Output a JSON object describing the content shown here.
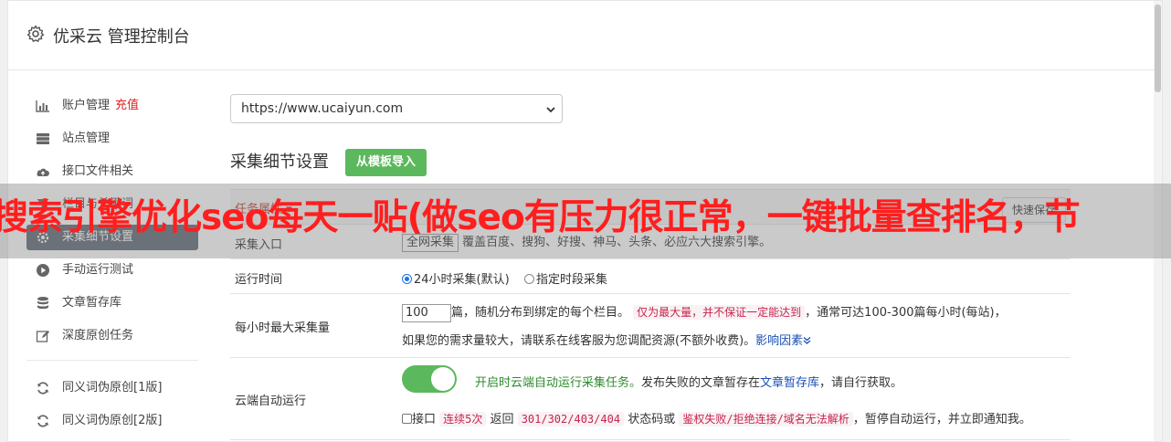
{
  "header": {
    "title": "优采云 管理控制台"
  },
  "sidebar": {
    "items": [
      {
        "label": "账户管理",
        "badge": "充值",
        "icon": "bar-chart-icon"
      },
      {
        "label": "站点管理",
        "icon": "server-icon"
      },
      {
        "label": "接口文件相关",
        "icon": "cloud-upload-icon"
      },
      {
        "label": "栏目与关键词",
        "icon": "filter-icon"
      },
      {
        "label": "采集细节设置",
        "icon": "gear-icon"
      },
      {
        "label": "手动运行测试",
        "icon": "play-icon"
      },
      {
        "label": "文章暂存库",
        "icon": "database-icon"
      },
      {
        "label": "深度原创任务",
        "icon": "edit-icon"
      },
      {
        "label": "同义词伪原创[1版]",
        "icon": "refresh-icon"
      },
      {
        "label": "同义词伪原创[2版]",
        "icon": "refresh-icon"
      }
    ]
  },
  "site_select": {
    "value": "https://www.ucaiyun.com"
  },
  "section": {
    "title": "采集细节设置",
    "import_button": "从模板导入"
  },
  "table": {
    "task_attr": "任务属性 ▾",
    "quick_save": "快速保存",
    "rows": {
      "entry": {
        "label": "采集入口",
        "input": "全网采集",
        "desc": "覆盖百度、搜狗、好搜、神马、头条、必应六大搜索引擎。"
      },
      "runtime": {
        "label": "运行时间",
        "opt1": "24小时采集(默认)",
        "opt2": "指定时段采集"
      },
      "max": {
        "label": "每小时最大采集量",
        "value": "100",
        "t1": "篇，随机分布到绑定的每个栏目。",
        "tag": "仅为最大量，并不保证一定能达到",
        "t2": "，通常可达100-300篇每小时(每站)，",
        "t3": "如果您的需求量较大，请联系在线客服为您调配资源(不额外收费)。",
        "link": "影响因素",
        "link_icon": "double-chevron-down-icon"
      },
      "cloud": {
        "label": "云端自动运行",
        "t1": "开启时云端自动运行采集任务。",
        "t2": "发布失败的文章暂存在",
        "link": "文章暂存库",
        "t3": "，请自行获取。",
        "c1": "接口",
        "tag1": "连续5次",
        "c2": "返回",
        "tag2": "301/302/403/404",
        "c3": "状态码或",
        "tag3": "鉴权失败/拒绝连接/域名无法解析",
        "c4": "，暂停自动运行，并立即通知我。"
      }
    }
  },
  "overlay": {
    "text": "搜索引擎优化seo每天一贴(做seo有压力很正常，一键批量查排名，节"
  },
  "colors": {
    "accent_green": "#5cb85c",
    "sidebar_active": "#5c6772",
    "overlay_text": "#ff1e1e"
  }
}
